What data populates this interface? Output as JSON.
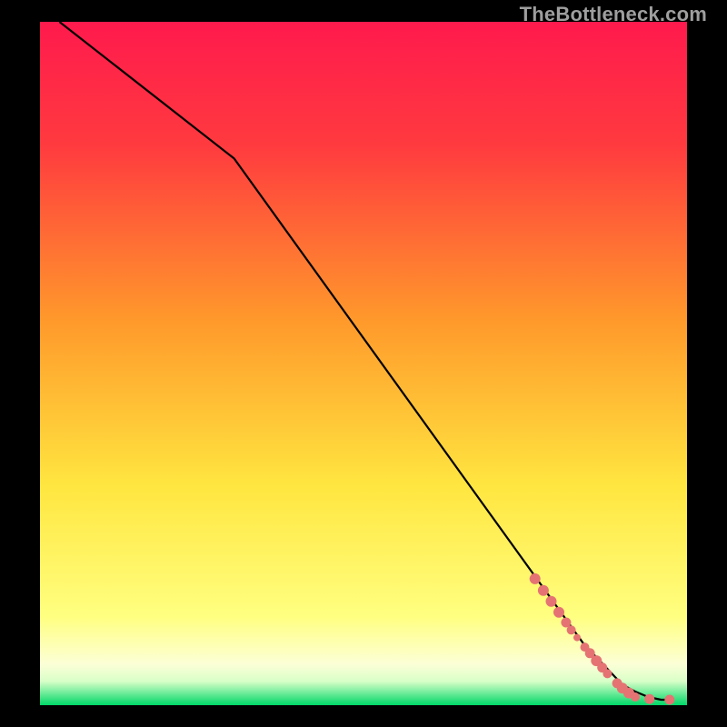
{
  "watermark": "TheBottleneck.com",
  "colors": {
    "frame_bg": "#000000",
    "line": "#000000",
    "marker": "#e57373",
    "grad_top": "#ff1a4d",
    "grad_mid1": "#ff8a2b",
    "grad_mid2": "#ffe640",
    "grad_mid3": "#fffacc",
    "grad_bottom": "#00e070"
  },
  "chart_data": {
    "type": "line",
    "title": "",
    "xlabel": "",
    "ylabel": "",
    "xlim": [
      0,
      100
    ],
    "ylim": [
      0,
      100
    ],
    "series": [
      {
        "name": "curve",
        "x": [
          3,
          30,
          84,
          90,
          92,
          94,
          96,
          98
        ],
        "y": [
          100,
          80,
          9,
          3,
          2,
          1.2,
          0.8,
          0.8
        ]
      }
    ],
    "markers": [
      {
        "x": 76.5,
        "y": 18.5,
        "r": 6
      },
      {
        "x": 77.8,
        "y": 16.8,
        "r": 6
      },
      {
        "x": 79.0,
        "y": 15.2,
        "r": 6
      },
      {
        "x": 80.2,
        "y": 13.6,
        "r": 6
      },
      {
        "x": 81.3,
        "y": 12.1,
        "r": 5.5
      },
      {
        "x": 82.1,
        "y": 11.0,
        "r": 5
      },
      {
        "x": 83.0,
        "y": 9.9,
        "r": 4
      },
      {
        "x": 84.2,
        "y": 8.5,
        "r": 5
      },
      {
        "x": 85.0,
        "y": 7.6,
        "r": 5.5
      },
      {
        "x": 86.0,
        "y": 6.5,
        "r": 6
      },
      {
        "x": 86.9,
        "y": 5.5,
        "r": 5.5
      },
      {
        "x": 87.7,
        "y": 4.6,
        "r": 5
      },
      {
        "x": 89.2,
        "y": 3.2,
        "r": 5.5
      },
      {
        "x": 90.0,
        "y": 2.5,
        "r": 6
      },
      {
        "x": 91.0,
        "y": 1.8,
        "r": 6
      },
      {
        "x": 92.0,
        "y": 1.2,
        "r": 5
      },
      {
        "x": 94.2,
        "y": 0.9,
        "r": 5.5
      },
      {
        "x": 97.3,
        "y": 0.8,
        "r": 5.5
      }
    ],
    "gradient_bands": [
      {
        "y": 100,
        "color": "#ff1a4d"
      },
      {
        "y": 55,
        "color": "#ff8a2b"
      },
      {
        "y": 30,
        "color": "#ffe640"
      },
      {
        "y": 10,
        "color": "#ffff80"
      },
      {
        "y": 5,
        "color": "#fffacc"
      },
      {
        "y": 0,
        "color": "#00e070"
      }
    ]
  }
}
